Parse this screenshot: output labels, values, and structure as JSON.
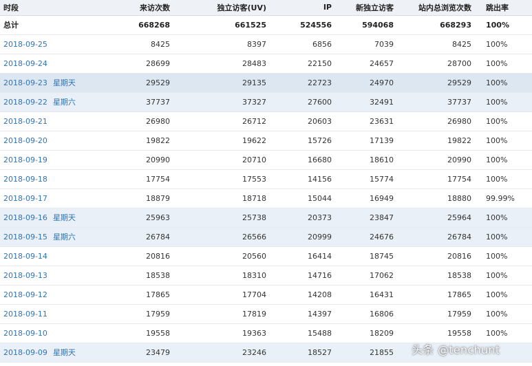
{
  "headers": {
    "period": "时段",
    "pv": "来访次数",
    "uv": "独立访客(UV)",
    "ip": "IP",
    "new_uv": "新独立访客",
    "site_pv": "站内总浏览次数",
    "bounce": "跳出率"
  },
  "total": {
    "label": "总计",
    "pv": "668268",
    "uv": "661525",
    "ip": "524556",
    "new_uv": "594068",
    "site_pv": "668293",
    "bounce": "100%"
  },
  "rows": [
    {
      "date": "2018-09-25",
      "weekday": "",
      "pv": "8425",
      "uv": "8397",
      "ip": "6856",
      "new_uv": "7039",
      "site_pv": "8425",
      "bounce": "100%"
    },
    {
      "date": "2018-09-24",
      "weekday": "",
      "pv": "28699",
      "uv": "28483",
      "ip": "22150",
      "new_uv": "24657",
      "site_pv": "28700",
      "bounce": "100%"
    },
    {
      "date": "2018-09-23",
      "weekday": "星期天",
      "pv": "29529",
      "uv": "29135",
      "ip": "22723",
      "new_uv": "24970",
      "site_pv": "29529",
      "bounce": "100%"
    },
    {
      "date": "2018-09-22",
      "weekday": "星期六",
      "pv": "37737",
      "uv": "37327",
      "ip": "27600",
      "new_uv": "32491",
      "site_pv": "37737",
      "bounce": "100%"
    },
    {
      "date": "2018-09-21",
      "weekday": "",
      "pv": "26980",
      "uv": "26712",
      "ip": "20603",
      "new_uv": "23631",
      "site_pv": "26980",
      "bounce": "100%"
    },
    {
      "date": "2018-09-20",
      "weekday": "",
      "pv": "19822",
      "uv": "19622",
      "ip": "15726",
      "new_uv": "17139",
      "site_pv": "19822",
      "bounce": "100%"
    },
    {
      "date": "2018-09-19",
      "weekday": "",
      "pv": "20990",
      "uv": "20710",
      "ip": "16680",
      "new_uv": "18610",
      "site_pv": "20990",
      "bounce": "100%"
    },
    {
      "date": "2018-09-18",
      "weekday": "",
      "pv": "17754",
      "uv": "17553",
      "ip": "14156",
      "new_uv": "15774",
      "site_pv": "17754",
      "bounce": "100%"
    },
    {
      "date": "2018-09-17",
      "weekday": "",
      "pv": "18879",
      "uv": "18718",
      "ip": "15044",
      "new_uv": "16949",
      "site_pv": "18880",
      "bounce": "99.99%"
    },
    {
      "date": "2018-09-16",
      "weekday": "星期天",
      "pv": "25963",
      "uv": "25738",
      "ip": "20373",
      "new_uv": "23847",
      "site_pv": "25964",
      "bounce": "100%"
    },
    {
      "date": "2018-09-15",
      "weekday": "星期六",
      "pv": "26784",
      "uv": "26566",
      "ip": "20999",
      "new_uv": "24676",
      "site_pv": "26784",
      "bounce": "100%"
    },
    {
      "date": "2018-09-14",
      "weekday": "",
      "pv": "20816",
      "uv": "20560",
      "ip": "16414",
      "new_uv": "18745",
      "site_pv": "20816",
      "bounce": "100%"
    },
    {
      "date": "2018-09-13",
      "weekday": "",
      "pv": "18538",
      "uv": "18310",
      "ip": "14716",
      "new_uv": "17062",
      "site_pv": "18538",
      "bounce": "100%"
    },
    {
      "date": "2018-09-12",
      "weekday": "",
      "pv": "17865",
      "uv": "17704",
      "ip": "14208",
      "new_uv": "16431",
      "site_pv": "17865",
      "bounce": "100%"
    },
    {
      "date": "2018-09-11",
      "weekday": "",
      "pv": "17959",
      "uv": "17819",
      "ip": "14397",
      "new_uv": "16806",
      "site_pv": "17959",
      "bounce": "100%"
    },
    {
      "date": "2018-09-10",
      "weekday": "",
      "pv": "19558",
      "uv": "19363",
      "ip": "15488",
      "new_uv": "18209",
      "site_pv": "19558",
      "bounce": "100%"
    },
    {
      "date": "2018-09-09",
      "weekday": "星期天",
      "pv": "23479",
      "uv": "23246",
      "ip": "18527",
      "new_uv": "21855",
      "site_pv": "",
      "bounce": ""
    }
  ],
  "watermark": "头条 @tenchunt",
  "colors": {
    "link": "#2f74b5",
    "weekend_row_bg": "#e9f0f8",
    "header_bg": "#eef1f5"
  }
}
